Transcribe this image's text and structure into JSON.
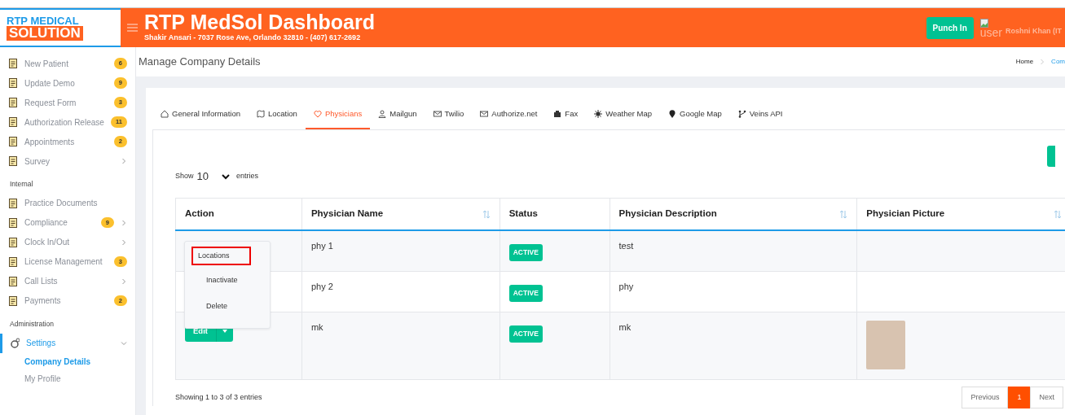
{
  "logo": {
    "line_1": "RTP MEDICAL",
    "line_2": "SOLUTION"
  },
  "header": {
    "title": "RTP MedSol Dashboard",
    "subtitle": "Shakir Ansari - 7037 Rose Ave, Orlando 32810 - (407) 617-2692",
    "punch_button": "Punch In",
    "user_image_alt": "user",
    "user_name": "Roshni Khan (IT"
  },
  "sidebar": {
    "sections": [
      {
        "items": [
          {
            "label": "New Patient",
            "badge": "6",
            "has_submenu": false,
            "selected": false
          },
          {
            "label": "Update Demo",
            "badge": "9",
            "has_submenu": false,
            "selected": false
          },
          {
            "label": "Request Form",
            "badge": "3",
            "has_submenu": false,
            "selected": false
          },
          {
            "label": "Authorization Release",
            "badge": "11",
            "has_submenu": false,
            "selected": false
          },
          {
            "label": "Appointments",
            "badge": "2",
            "has_submenu": false,
            "selected": false
          },
          {
            "label": "Survey",
            "has_submenu": true,
            "selected": false
          }
        ]
      },
      {
        "heading": "Internal",
        "items": [
          {
            "label": "Practice Documents",
            "has_submenu": false,
            "selected": false
          },
          {
            "label": "Compliance",
            "badge": "9",
            "has_submenu": true,
            "selected": false
          },
          {
            "label": "Clock In/Out",
            "has_submenu": true,
            "selected": false
          },
          {
            "label": "License Management",
            "badge": "3",
            "has_submenu": false,
            "selected": false
          },
          {
            "label": "Call Lists",
            "has_submenu": true,
            "selected": false
          },
          {
            "label": "Payments",
            "badge": "2",
            "has_submenu": false,
            "selected": false
          }
        ]
      },
      {
        "heading": "Administration",
        "items": [
          {
            "label": "Settings",
            "has_submenu": true,
            "selected": true,
            "expanded": true,
            "children": [
              {
                "label": "Company Details",
                "selected": true
              },
              {
                "label": "My Profile",
                "selected": false
              }
            ]
          }
        ]
      }
    ]
  },
  "page_title": "Manage Company Details",
  "breadcrumb": [
    {
      "label": "Home",
      "current": false
    },
    {
      "label": "Com",
      "current": true
    }
  ],
  "tabs": [
    {
      "label": "General Information",
      "selected": false
    },
    {
      "label": "Location",
      "selected": false
    },
    {
      "label": "Physicians",
      "selected": true
    },
    {
      "label": "Mailgun",
      "selected": false
    },
    {
      "label": "Twilio",
      "selected": false
    },
    {
      "label": "Authorize.net",
      "selected": false
    },
    {
      "label": "Fax",
      "selected": false
    },
    {
      "label": "Weather Map",
      "selected": false
    },
    {
      "label": "Google Map",
      "selected": false
    },
    {
      "label": "Veins API",
      "selected": false
    }
  ],
  "length_menu": {
    "before": "Show",
    "value": "10",
    "after": "entries"
  },
  "table": {
    "columns": [
      {
        "label": "Action",
        "sortable": false
      },
      {
        "label": "Physician Name",
        "sortable": true
      },
      {
        "label": "Status",
        "sortable": false
      },
      {
        "label": "Physician Description",
        "sortable": true
      },
      {
        "label": "Physician Picture",
        "sortable": true
      }
    ],
    "rows": [
      {
        "name": "phy 1",
        "status": "ACTIVE",
        "description": "test",
        "has_picture": false
      },
      {
        "name": "phy 2",
        "status": "ACTIVE",
        "description": "phy",
        "has_picture": false
      },
      {
        "edit_button": "Edit",
        "name": "mk",
        "status": "ACTIVE",
        "description": "mk",
        "has_picture": true
      }
    ]
  },
  "action_menu": {
    "items": [
      {
        "label": "Locations",
        "highlighted": true
      },
      {
        "label": "Inactivate",
        "highlighted": false
      },
      {
        "label": "Delete",
        "highlighted": false
      }
    ]
  },
  "info": "Showing 1 to 3 of 3 entries",
  "pagination": [
    {
      "label": "Previous",
      "selected": false
    },
    {
      "label": "1",
      "selected": true
    },
    {
      "label": "Next",
      "selected": false
    }
  ]
}
